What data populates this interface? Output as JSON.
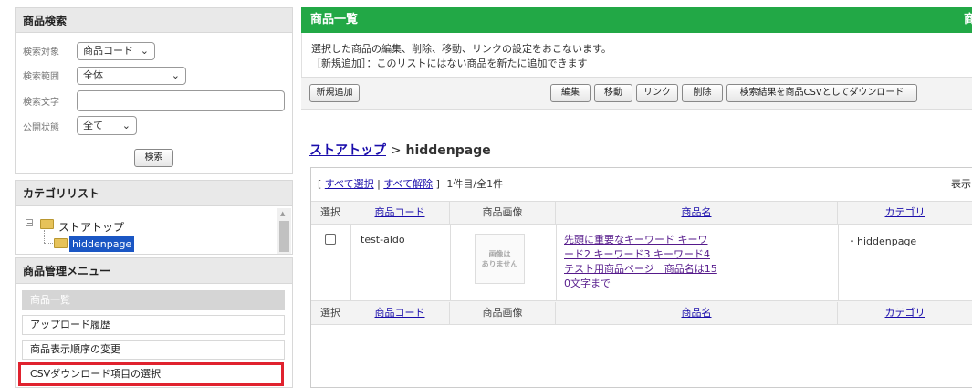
{
  "search_panel": {
    "title": "商品検索",
    "target_label": "検索対象",
    "target_value": "商品コード",
    "range_label": "検索範囲",
    "range_value": "全体",
    "text_label": "検索文字",
    "text_value": "",
    "visibility_label": "公開状態",
    "visibility_value": "全て",
    "search_button": "検索"
  },
  "category_panel": {
    "title": "カテゴリリスト",
    "root": "ストアトップ",
    "child": "hiddenpage"
  },
  "menu_panel": {
    "title": "商品管理メニュー",
    "items": [
      "商品一覧",
      "アップロード履歴",
      "商品表示順序の変更",
      "CSVダウンロード項目の選択"
    ]
  },
  "main": {
    "title": "商品一覧",
    "title_right": "商",
    "desc_line1": "選択した商品の編集、削除、移動、リンクの設定をおこないます。",
    "desc_line2": "［新規追加］：このリストにはない商品を新たに追加できます",
    "toolbar": {
      "new": "新規追加",
      "edit": "編集",
      "move": "移動",
      "link": "リンク",
      "delete": "削除",
      "csv": "検索結果を商品CSVとしてダウンロード"
    },
    "breadcrumb_root": "ストアトップ",
    "breadcrumb_sep": ">",
    "breadcrumb_current": "hiddenpage",
    "list_bar": {
      "open": "[",
      "select_all": "すべて選択",
      "sep": "|",
      "deselect_all": "すべて解除",
      "close": "]",
      "count": "1件目/全1件",
      "display": "表示"
    },
    "columns": {
      "select": "選択",
      "code": "商品コード",
      "image": "商品画像",
      "name": "商品名",
      "category": "カテゴリ"
    },
    "row": {
      "code": "test-aldo",
      "no_image_line1": "画像は",
      "no_image_line2": "ありません",
      "name_lines": [
        "先頭に重要なキーワード キーワ",
        "ード2 キーワード3 キーワード4",
        "テスト用商品ページ　商品名は15",
        "0文字まで"
      ],
      "category": "・hiddenpage"
    }
  },
  "colors": {
    "header_green": "#22a846",
    "highlight_red": "#e0222e",
    "selected_blue": "#1a56c4",
    "link": "#1a0dab"
  }
}
